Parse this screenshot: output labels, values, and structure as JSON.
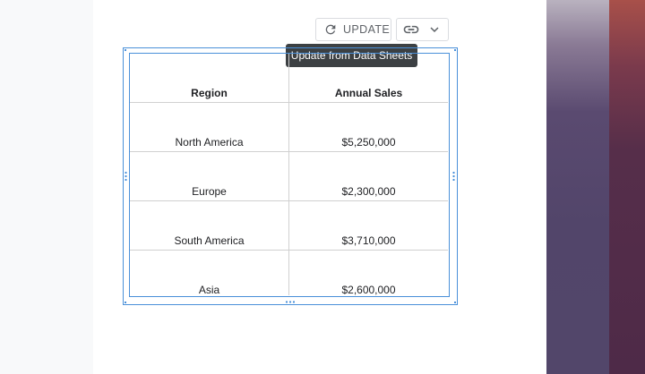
{
  "toolbar": {
    "update_label": "UPDATE",
    "refresh_icon": "refresh-icon",
    "link_icon": "link-icon",
    "dropdown_icon": "chevron-down-icon"
  },
  "tooltip": {
    "text": "Update from Data Sheets"
  },
  "table": {
    "columns": [
      "Region",
      "Annual Sales"
    ],
    "rows": [
      [
        "North America",
        "$5,250,000"
      ],
      [
        "Europe",
        "$2,300,000"
      ],
      [
        "South America",
        "$3,710,000"
      ],
      [
        "Asia",
        "$2,600,000"
      ]
    ]
  },
  "colors": {
    "selection": "#4a90d9",
    "tooltip_bg": "#3c4043"
  }
}
